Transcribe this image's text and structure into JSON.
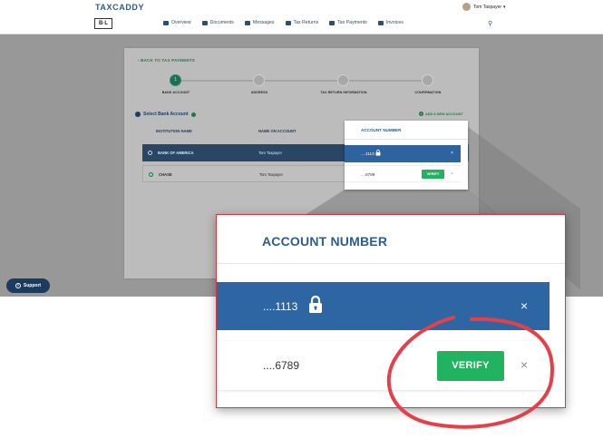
{
  "header": {
    "logo_text": "TAXCADDY",
    "user_name": "Tom Taxpayer",
    "bl_logo": "B·L",
    "nav": [
      "Overview",
      "Documents",
      "Messages",
      "Tax Returns",
      "Tax Payments",
      "Invoices"
    ]
  },
  "card": {
    "back_link": "BACK TO TAX PAYMENTS",
    "steps": [
      "BANK ACCOUNT",
      "ADDRESS",
      "TAX RETURN INFORMATION",
      "CONFIRMATION"
    ],
    "active_step_number": "1",
    "section_title": "Select Bank Account",
    "add_account": "ADD A NEW ACCOUNT",
    "columns": {
      "institution": "INSTITUTION NAME",
      "owner": "NAME ON ACCOUNT"
    },
    "rows": [
      {
        "institution": "BANK OF AMERICA",
        "owner": "Tom Taxpayer"
      },
      {
        "institution": "CHASE",
        "owner": "Tom Taxpayer"
      }
    ]
  },
  "account_popup": {
    "header": "ACCOUNT NUMBER",
    "rows": [
      {
        "number": "....1113",
        "close": "×"
      },
      {
        "number": "....6789",
        "verify_label": "VERIFY",
        "close": "×"
      }
    ]
  },
  "support": {
    "label": "Support"
  },
  "colors": {
    "accent_green": "#22b361",
    "selected_row": "#2d66a3",
    "callout_border": "#d9363e",
    "annotation_circle": "#e5404a"
  }
}
